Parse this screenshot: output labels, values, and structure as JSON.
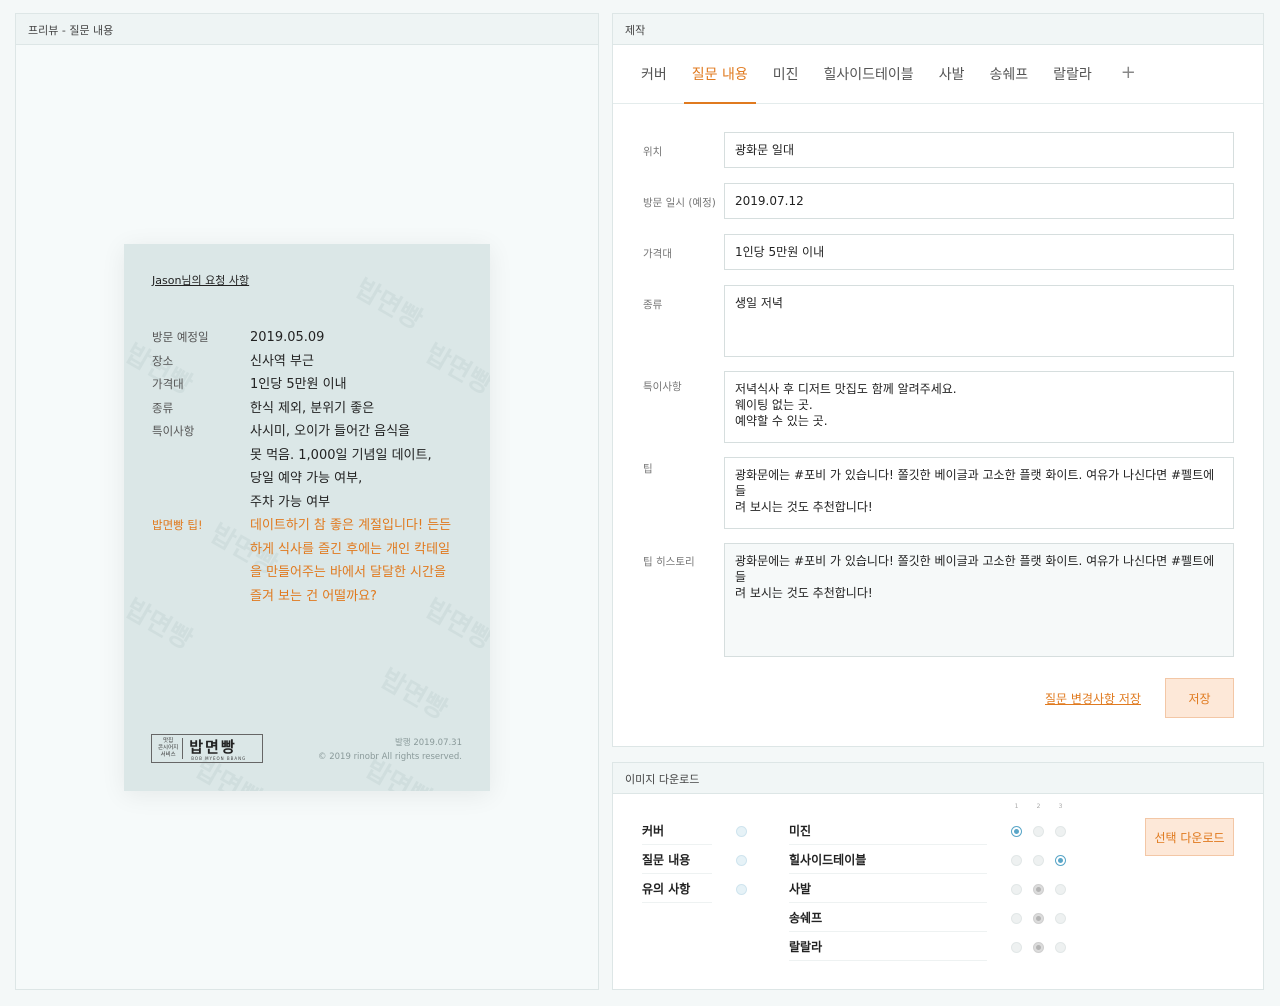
{
  "preview": {
    "header": "프리뷰 - 질문 내용",
    "card": {
      "title": "Jason님의 요청 사항",
      "rows": [
        {
          "key": "방문 예정일",
          "lines": [
            "2019.05.09"
          ]
        },
        {
          "key": "장소",
          "lines": [
            "신사역 부근"
          ]
        },
        {
          "key": "가격대",
          "lines": [
            "1인당 5만원 이내"
          ]
        },
        {
          "key": "종류",
          "lines": [
            "한식 제외, 분위기 좋은"
          ]
        },
        {
          "key": "특이사항",
          "lines": [
            "사시미, 오이가 들어간 음식을",
            "못 먹음. 1,000일 기념일 데이트,",
            "당일 예약 가능 여부,",
            "주차 가능 여부"
          ]
        }
      ],
      "tip": {
        "key": "밥면빵 팁!",
        "lines": [
          "데이트하기 참 좋은 계절입니다! 든든",
          "하게 식사를 즐긴 후에는 개인 칵테일",
          "을 만들어주는 바에서 달달한 시간을",
          "즐겨 보는 건 어떨까요?"
        ]
      },
      "watermark": "밥면빵",
      "logo": {
        "small_lines": [
          "맛집",
          "콘시어지",
          "서비스"
        ],
        "name": "밥면빵",
        "sub": "BOB MYEON BBANG"
      },
      "published": "발행 2019.07.31",
      "copyright": "© 2019 rinobr All rights reserved."
    }
  },
  "editor": {
    "header": "제작",
    "tabs": [
      {
        "label": "커버",
        "active": false
      },
      {
        "label": "질문 내용",
        "active": true
      },
      {
        "label": "미진",
        "active": false
      },
      {
        "label": "힐사이드테이블",
        "active": false
      },
      {
        "label": "사발",
        "active": false
      },
      {
        "label": "송쉐프",
        "active": false
      },
      {
        "label": "랄랄라",
        "active": false
      }
    ],
    "add_tab": "+",
    "fields": {
      "location": {
        "label": "위치",
        "value": "광화문 일대"
      },
      "visit_date": {
        "label": "방문 일시 (예정)",
        "value": "2019.07.12"
      },
      "price": {
        "label": "가격대",
        "value": "1인당 5만원 이내"
      },
      "type": {
        "label": "종류",
        "value": "생일 저녁"
      },
      "notes": {
        "label": "특이사항",
        "lines": [
          "저녁식사 후 디저트 맛집도 함께 알려주세요.",
          "웨이팅 없는 곳.",
          "예약할 수 있는 곳."
        ]
      },
      "tip": {
        "label": "팁",
        "lines": [
          "광화문에는 #포비 가 있습니다! 쫄깃한 베이글과 고소한 플랫 화이트. 여유가 나신다면 #펠트에 들",
          "려 보시는 것도 추천합니다!"
        ]
      },
      "tip_history": {
        "label": "팁 히스토리",
        "lines": [
          "광화문에는 #포비 가 있습니다! 쫄깃한 베이글과 고소한 플랫 화이트. 여유가 나신다면 #펠트에 들",
          "려 보시는 것도 추천합니다!"
        ]
      }
    },
    "save_changes_link": "질문 변경사항 저장",
    "save_button": "저장"
  },
  "download": {
    "header": "이미지 다운로드",
    "left_items": [
      {
        "label": "커버",
        "selected": true
      },
      {
        "label": "질문 내용",
        "selected": true
      },
      {
        "label": "유의 사항",
        "selected": true
      }
    ],
    "column_numbers": [
      "1",
      "2",
      "3"
    ],
    "right_items": [
      {
        "label": "미진",
        "state": [
          "on",
          "off",
          "off"
        ]
      },
      {
        "label": "힐사이드테이블",
        "state": [
          "off",
          "off",
          "on"
        ]
      },
      {
        "label": "사발",
        "state": [
          "off",
          "mid",
          "off"
        ]
      },
      {
        "label": "송쉐프",
        "state": [
          "off",
          "mid",
          "off"
        ]
      },
      {
        "label": "랄랄라",
        "state": [
          "off",
          "mid",
          "off"
        ]
      }
    ],
    "download_button": "선택 다운로드"
  }
}
